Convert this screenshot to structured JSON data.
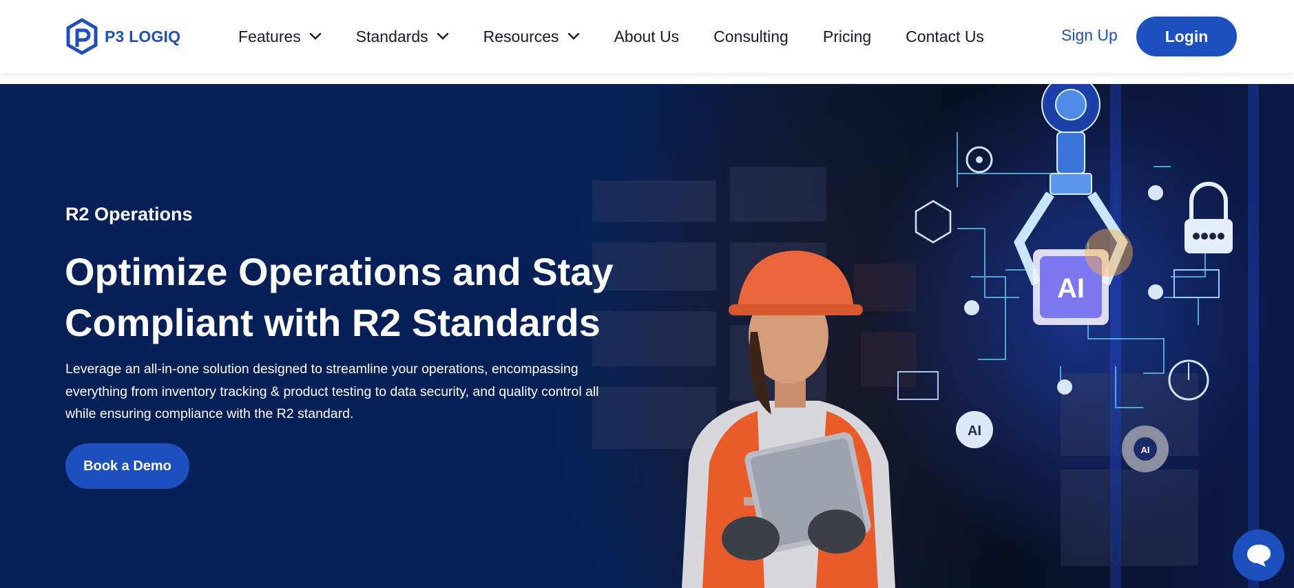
{
  "brand": {
    "name": "P3 LOGIQ",
    "color": "#1f4fb8"
  },
  "nav": {
    "items": [
      {
        "label": "Features",
        "has_dropdown": true
      },
      {
        "label": "Standards",
        "has_dropdown": true
      },
      {
        "label": "Resources",
        "has_dropdown": true
      },
      {
        "label": "About Us",
        "has_dropdown": false
      },
      {
        "label": "Consulting",
        "has_dropdown": false
      },
      {
        "label": "Pricing",
        "has_dropdown": false
      },
      {
        "label": "Contact Us",
        "has_dropdown": false
      }
    ],
    "signup_label": "Sign Up",
    "login_label": "Login"
  },
  "hero": {
    "eyebrow": "R2 Operations",
    "headline": "Optimize Operations and Stay Compliant with R2 Standards",
    "subtext": "Leverage an all-in-one solution designed to streamline your operations, encompassing everything from inventory tracking & product testing to data security, and quality control all while ensuring compliance with the R2 standard.",
    "cta_label": "Book a Demo",
    "background_color": "#072158",
    "chip_label": "AI",
    "bulb_label": "AI",
    "gear_label": "AI"
  },
  "colors": {
    "accent": "#1d4fbe",
    "nav_text": "#151a2e",
    "hero_text": "#ffffff"
  },
  "chat": {
    "icon": "chat-bubble-icon"
  }
}
